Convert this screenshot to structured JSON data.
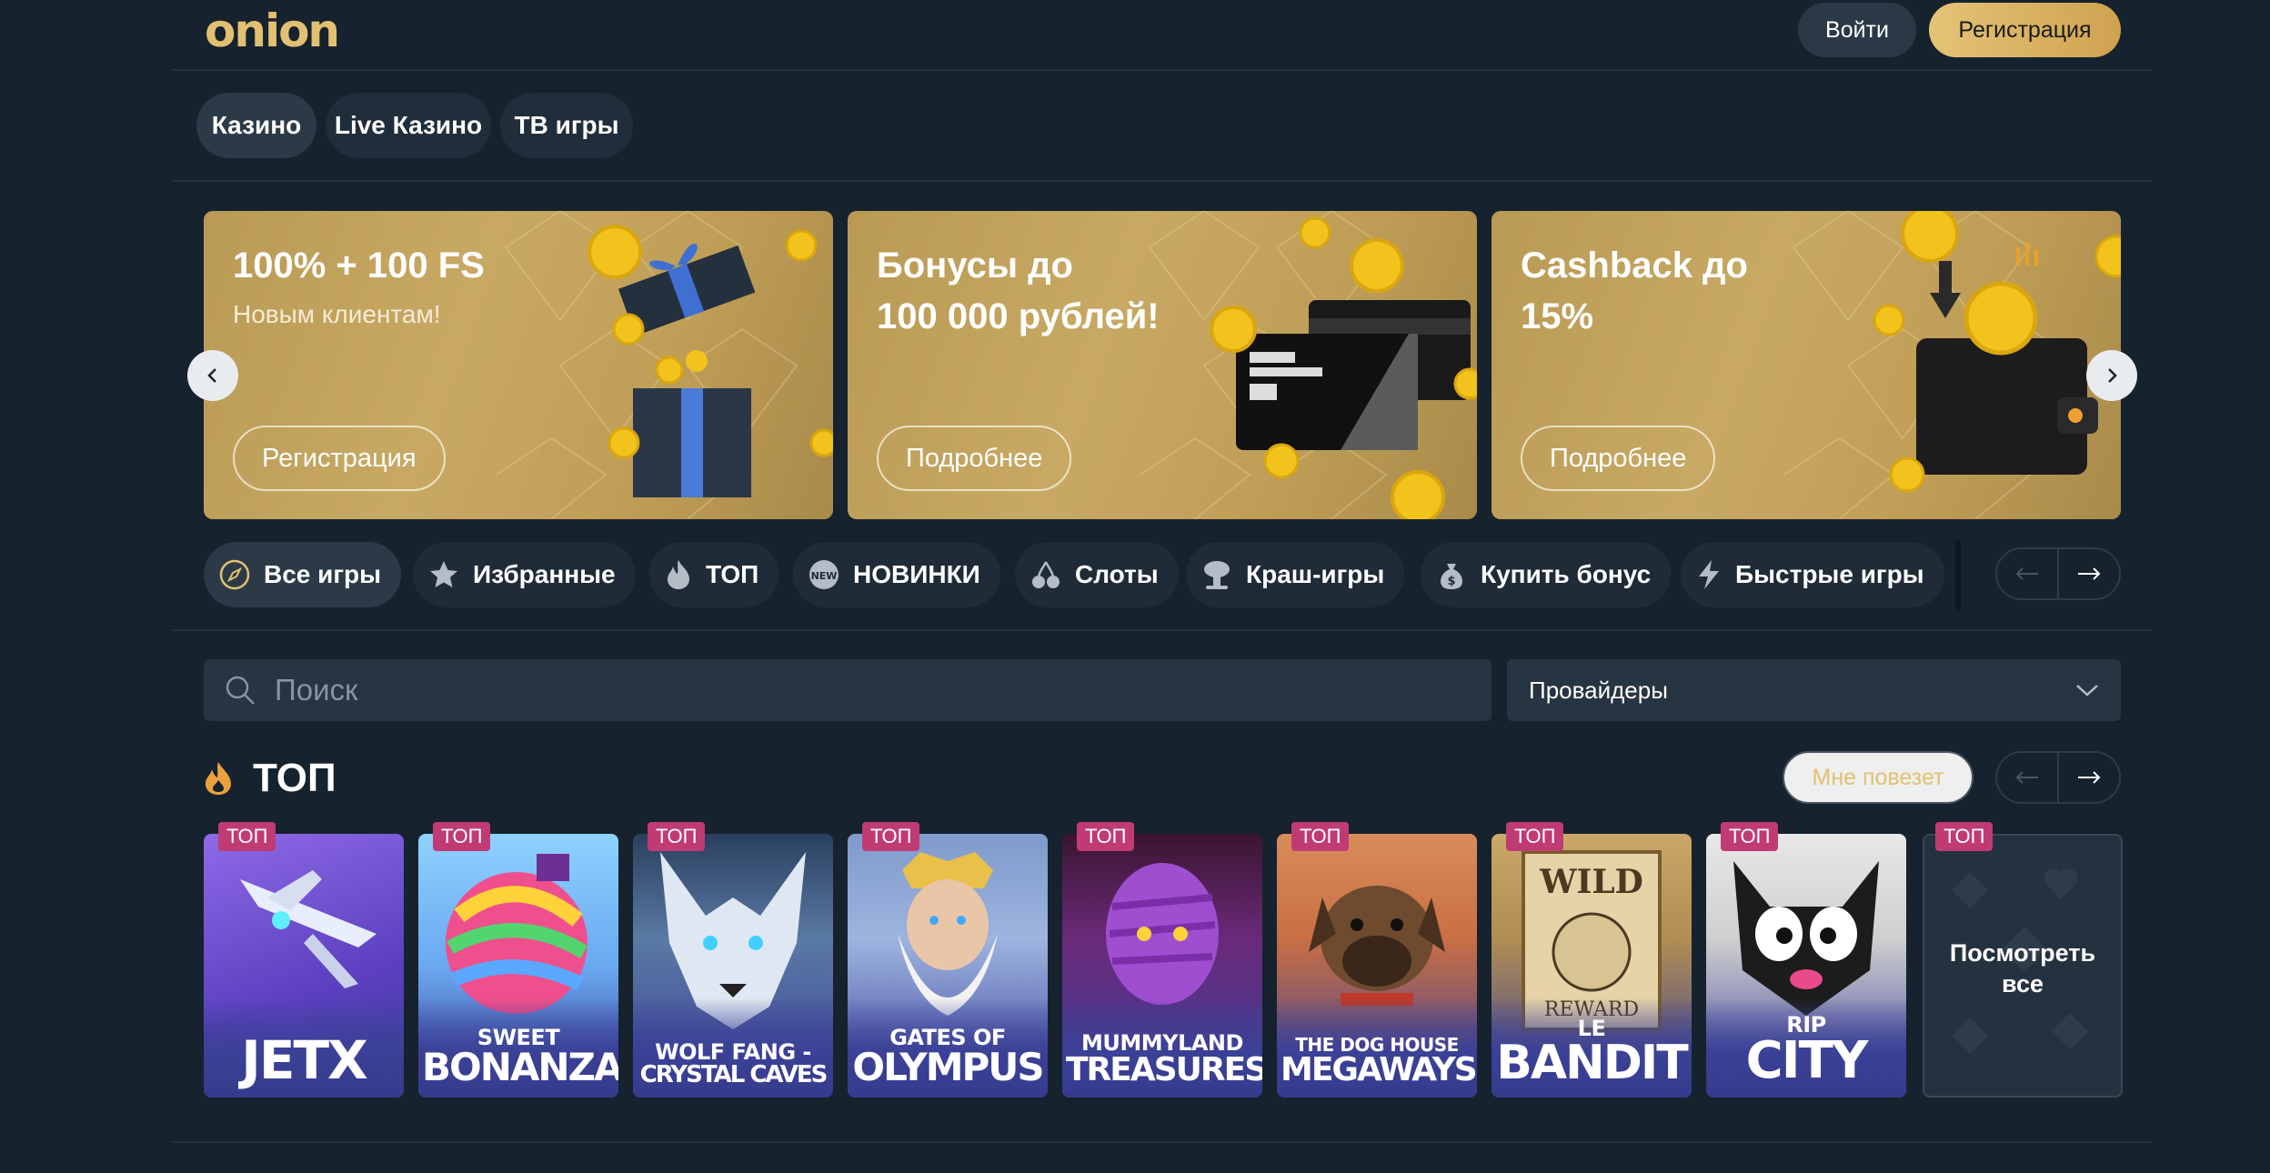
{
  "header": {
    "logo": "onion",
    "login_label": "Войти",
    "register_label": "Регистрация"
  },
  "top_tabs": [
    "Казино",
    "Live Казино",
    "ТВ игры"
  ],
  "banners": [
    {
      "title": "100% + 100 FS",
      "subtitle": "Новым клиентам!",
      "button": "Регистрация"
    },
    {
      "title": "Бонусы до\n100 000 рублей!",
      "subtitle": "",
      "button": "Подробнее"
    },
    {
      "title": "Cashback до\n15%",
      "subtitle": "",
      "button": "Подробнее"
    }
  ],
  "categories": [
    {
      "label": "Все игры",
      "icon": "compass-icon"
    },
    {
      "label": "Избранные",
      "icon": "star-icon"
    },
    {
      "label": "ТОП",
      "icon": "fire-icon"
    },
    {
      "label": "НОВИНКИ",
      "icon": "new-badge-icon"
    },
    {
      "label": "Слоты",
      "icon": "cherry-icon"
    },
    {
      "label": "Краш-игры",
      "icon": "explosion-icon"
    },
    {
      "label": "Купить бонус",
      "icon": "money-bag-icon"
    },
    {
      "label": "Быстрые игры",
      "icon": "lightning-icon"
    }
  ],
  "search": {
    "placeholder": "Поиск"
  },
  "providers": {
    "label": "Провайдеры"
  },
  "top_section": {
    "title": "ТОП",
    "lucky_label": "Мне повезет",
    "badge": "ТОП",
    "games": [
      {
        "line1": "",
        "line2": "JETX"
      },
      {
        "line1": "SWEET",
        "line2": "BONANZA"
      },
      {
        "line1": "WOLF FANG -",
        "line2": "CRYSTAL CAVES"
      },
      {
        "line1": "GATES OF",
        "line2": "OLYMPUS"
      },
      {
        "line1": "MUMMYLAND",
        "line2": "TREASURES"
      },
      {
        "line1": "THE DOG HOUSE",
        "line2": "MEGAWAYS"
      },
      {
        "line1": "LE",
        "line2": "BANDIT"
      },
      {
        "line1": "RIP",
        "line2": "CITY"
      }
    ],
    "view_all": "Посмотреть\nвсе"
  },
  "colors": {
    "background": "#16222e",
    "accent": "#e1c171",
    "badge": "#c03b74",
    "banner": "#c2a25c"
  }
}
